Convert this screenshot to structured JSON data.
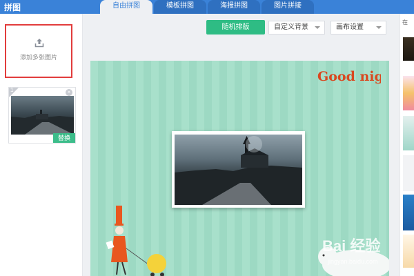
{
  "app": {
    "title": "拼图"
  },
  "tabs": [
    {
      "label": "自由拼图",
      "active": true
    },
    {
      "label": "模板拼图",
      "active": false
    },
    {
      "label": "海报拼图",
      "active": false
    },
    {
      "label": "图片拼接",
      "active": false
    }
  ],
  "left_panel": {
    "add_label": "添加多张图片",
    "thumbnail": {
      "index": "1",
      "replace_label": "替换"
    }
  },
  "toolbar": {
    "random_label": "随机排版",
    "background_select": "自定义背景",
    "canvas_select": "画布设置"
  },
  "canvas": {
    "overlay_text": "Good night"
  },
  "watermark": {
    "logo": "Bai 经验",
    "sub": "jingyan.baidu.com"
  },
  "right_panel": {
    "label": "在"
  },
  "colors": {
    "topbar": "#3a82d8",
    "accent_green": "#2ebc84",
    "canvas_bg": "#a8e0cb",
    "highlight_red": "#e23c3c"
  }
}
